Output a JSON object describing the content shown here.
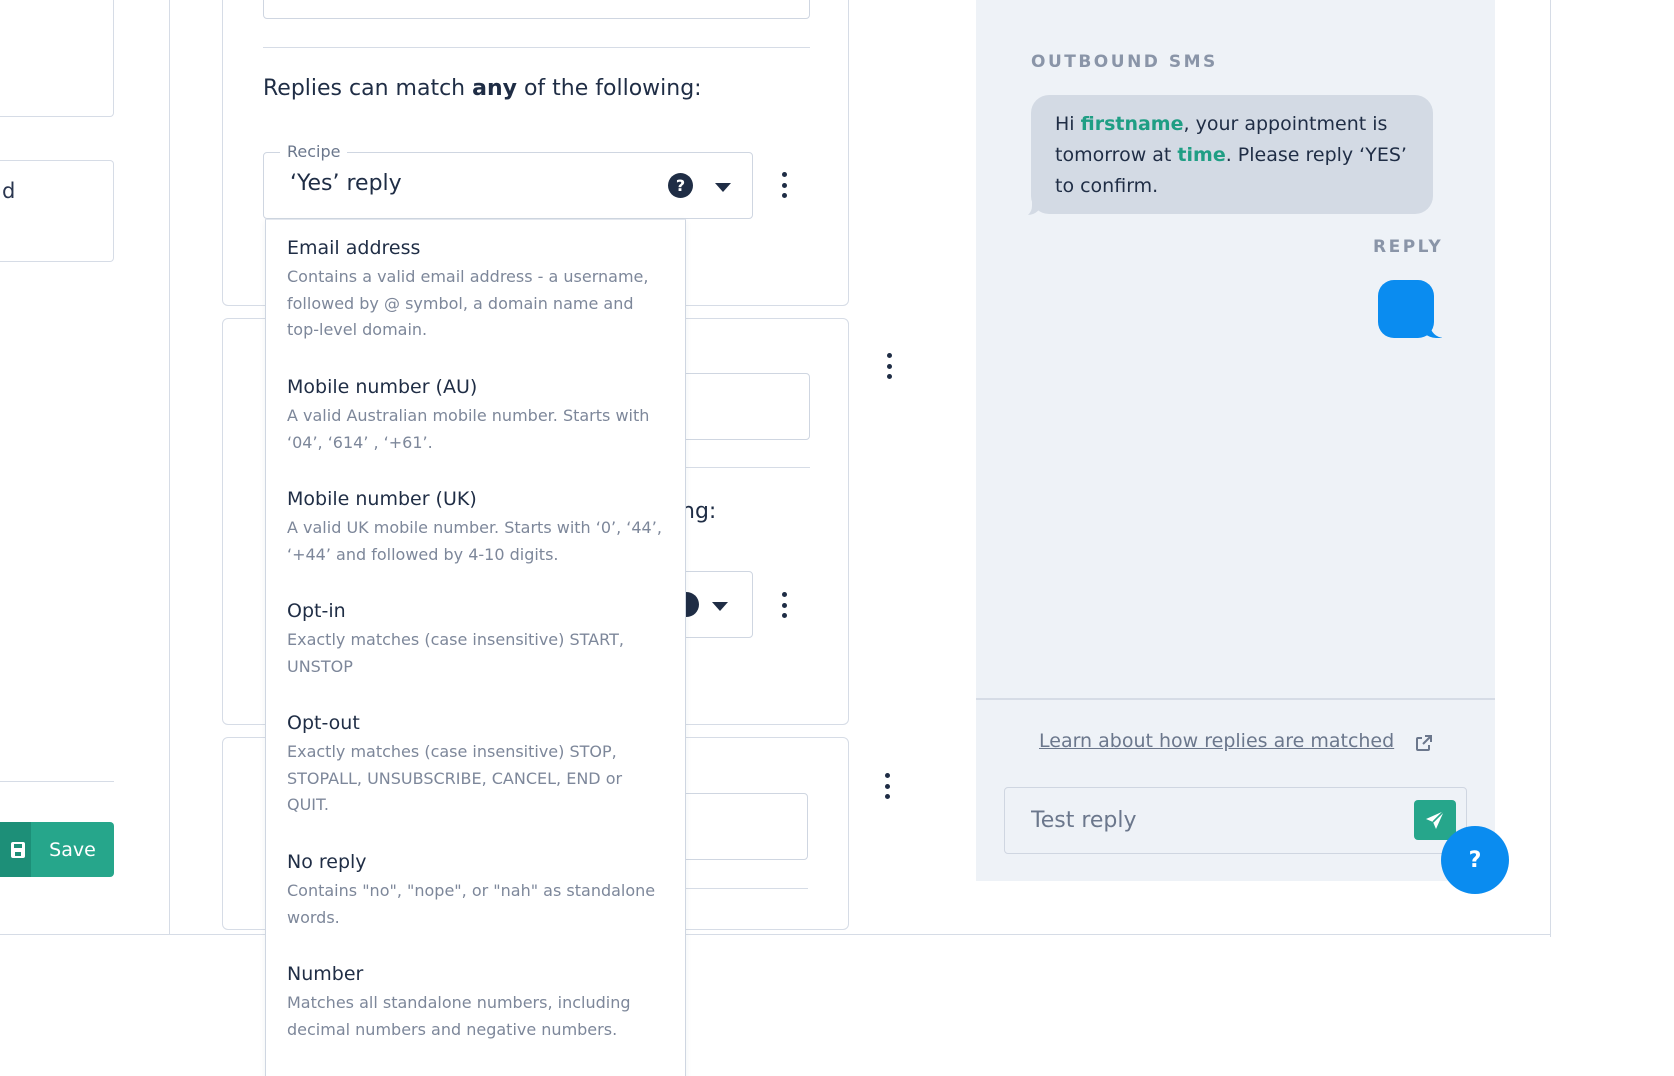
{
  "left": {
    "field_partial_text": "d",
    "save_label": "Save",
    "save_icon": "floppy-disk-icon"
  },
  "rule_card": {
    "replies_prefix": "Replies can match ",
    "replies_emphasis": "any",
    "replies_suffix": " of the following:",
    "select_legend": "Recipe",
    "select_value": "‘Yes’ reply",
    "help_icon_glyph": "?",
    "help_icon": "question-circle-icon",
    "caret_icon": "caret-down-icon",
    "menu_icon": "kebab-menu-icon"
  },
  "second_card": {
    "partial_heading": "ng:",
    "partial_help": ")"
  },
  "dropdown": {
    "options": [
      {
        "title": "Email address",
        "description": "Contains a valid email address - a username, followed by @ symbol, a domain name and top-level domain."
      },
      {
        "title": "Mobile number (AU)",
        "description": "A valid Australian mobile number. Starts with ‘04’, ‘614’ , ‘+61’."
      },
      {
        "title": "Mobile number (UK)",
        "description": "A valid UK mobile number. Starts with ‘0’, ‘44’, ‘+44’ and followed by 4-10 digits."
      },
      {
        "title": "Opt-in",
        "description": "Exactly matches (case insensitive) START, UNSTOP"
      },
      {
        "title": "Opt-out",
        "description": "Exactly matches (case insensitive) STOP, STOPALL, UNSUBSCRIBE, CANCEL, END or QUIT."
      },
      {
        "title": "No reply",
        "description": "Contains \"no\", \"nope\", or \"nah\" as standalone words."
      },
      {
        "title": "Number",
        "description": "Matches all standalone numbers, including decimal numbers and negative numbers."
      }
    ]
  },
  "sms_panel": {
    "outbound_label": "OUTBOUND SMS",
    "message_p1": "Hi ",
    "message_var1": "firstname",
    "message_p2": ", your appointment is tomorrow at ",
    "message_var2": "time",
    "message_p3": ". Please reply ‘YES’ to confirm.",
    "reply_label": "REPLY",
    "learn_link": "Learn about how replies are matched",
    "external_icon": "external-link-icon",
    "test_placeholder": "Test reply",
    "send_icon": "send-icon",
    "help_fab_glyph": "?",
    "help_fab_icon": "help-icon"
  },
  "colors": {
    "accent_green": "#26a68b",
    "accent_blue": "#0a8cf0",
    "text_dark": "#1f2d45",
    "panel_bg": "#eef2f7"
  }
}
